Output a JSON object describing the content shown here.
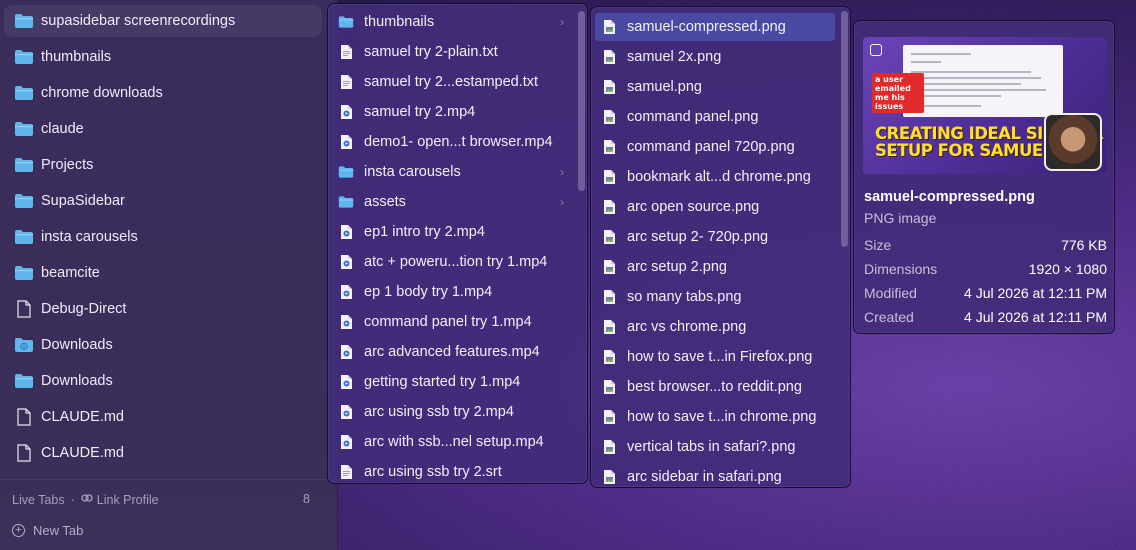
{
  "sidebar": {
    "items": [
      {
        "label": "supasidebar screenrecordings",
        "icon": "folder-icon",
        "active": true
      },
      {
        "label": "thumbnails",
        "icon": "folder-icon"
      },
      {
        "label": "chrome downloads",
        "icon": "folder-icon"
      },
      {
        "label": "claude",
        "icon": "folder-icon"
      },
      {
        "label": "Projects",
        "icon": "folder-icon"
      },
      {
        "label": "SupaSidebar",
        "icon": "folder-icon"
      },
      {
        "label": "insta carousels",
        "icon": "folder-icon"
      },
      {
        "label": "beamcite",
        "icon": "folder-icon"
      },
      {
        "label": "Debug-Direct",
        "icon": "document-icon"
      },
      {
        "label": "Downloads",
        "icon": "downloads-folder-icon"
      },
      {
        "label": "Downloads",
        "icon": "folder-icon"
      },
      {
        "label": "CLAUDE.md",
        "icon": "document-icon"
      },
      {
        "label": "CLAUDE.md",
        "icon": "document-icon"
      }
    ],
    "footer": {
      "live_tabs": "Live Tabs",
      "separator": "·",
      "link_profile": "Link Profile",
      "count": "8",
      "new_tab": "New Tab"
    }
  },
  "column1": {
    "items": [
      {
        "label": "thumbnails",
        "icon": "folder-icon",
        "chevron": "›"
      },
      {
        "label": "samuel try 2-plain.txt",
        "icon": "text-file-icon"
      },
      {
        "label": "samuel try 2...estamped.txt",
        "icon": "text-file-icon"
      },
      {
        "label": "samuel try 2.mp4",
        "icon": "video-file-icon"
      },
      {
        "label": "demo1- open...t browser.mp4",
        "icon": "video-file-icon"
      },
      {
        "label": "insta carousels",
        "icon": "folder-icon",
        "chevron": "›"
      },
      {
        "label": "assets",
        "icon": "folder-icon",
        "chevron": "›"
      },
      {
        "label": "ep1 intro try 2.mp4",
        "icon": "video-file-icon"
      },
      {
        "label": "atc + poweru...tion try 1.mp4",
        "icon": "video-file-icon"
      },
      {
        "label": "ep 1 body try 1.mp4",
        "icon": "video-file-icon"
      },
      {
        "label": "command panel try 1.mp4",
        "icon": "video-file-icon"
      },
      {
        "label": "arc advanced features.mp4",
        "icon": "video-file-icon"
      },
      {
        "label": "getting started try 1.mp4",
        "icon": "video-file-icon"
      },
      {
        "label": "arc using ssb try 2.mp4",
        "icon": "video-file-icon"
      },
      {
        "label": "arc with ssb...nel setup.mp4",
        "icon": "video-file-icon"
      },
      {
        "label": "arc using ssb try 2.srt",
        "icon": "text-file-icon"
      }
    ]
  },
  "column2": {
    "items": [
      {
        "label": "samuel-compressed.png",
        "icon": "image-file-icon",
        "selected": true
      },
      {
        "label": "samuel 2x.png",
        "icon": "image-file-icon"
      },
      {
        "label": "samuel.png",
        "icon": "image-file-icon"
      },
      {
        "label": "command panel.png",
        "icon": "image-file-icon"
      },
      {
        "label": "command panel 720p.png",
        "icon": "image-file-icon"
      },
      {
        "label": "bookmark alt...d chrome.png",
        "icon": "image-file-icon"
      },
      {
        "label": "arc open source.png",
        "icon": "image-file-icon"
      },
      {
        "label": "arc setup 2- 720p.png",
        "icon": "image-file-icon"
      },
      {
        "label": "arc setup 2.png",
        "icon": "image-file-icon"
      },
      {
        "label": "so many tabs.png",
        "icon": "image-file-icon"
      },
      {
        "label": "arc vs chrome.png",
        "icon": "image-file-icon"
      },
      {
        "label": "how to save t...in Firefox.png",
        "icon": "image-file-icon"
      },
      {
        "label": "best browser...to reddit.png",
        "icon": "image-file-icon"
      },
      {
        "label": "how to save t...in chrome.png",
        "icon": "image-file-icon"
      },
      {
        "label": "vertical tabs in safari?.png",
        "icon": "image-file-icon"
      },
      {
        "label": "arc sidebar in safari.png",
        "icon": "image-file-icon"
      }
    ]
  },
  "preview": {
    "thumbnail": {
      "badge": "a user emailed me his issues",
      "headline_line1": "CREATING IDEAL SIDEBAR",
      "headline_line2": "SETUP FOR SAMUEL"
    },
    "name": "samuel-compressed.png",
    "kind": "PNG image",
    "meta": [
      {
        "key": "Size",
        "value": "776 KB"
      },
      {
        "key": "Dimensions",
        "value": "1920 × 1080"
      },
      {
        "key": "Modified",
        "value": "4 Jul 2026 at 12:11 PM"
      },
      {
        "key": "Created",
        "value": "4 Jul 2026 at 12:11 PM"
      }
    ]
  },
  "colors": {
    "folder": "#5fb6ef",
    "selection": "#4e50aa",
    "panel": "#422c78",
    "headline": "#ffe028"
  }
}
